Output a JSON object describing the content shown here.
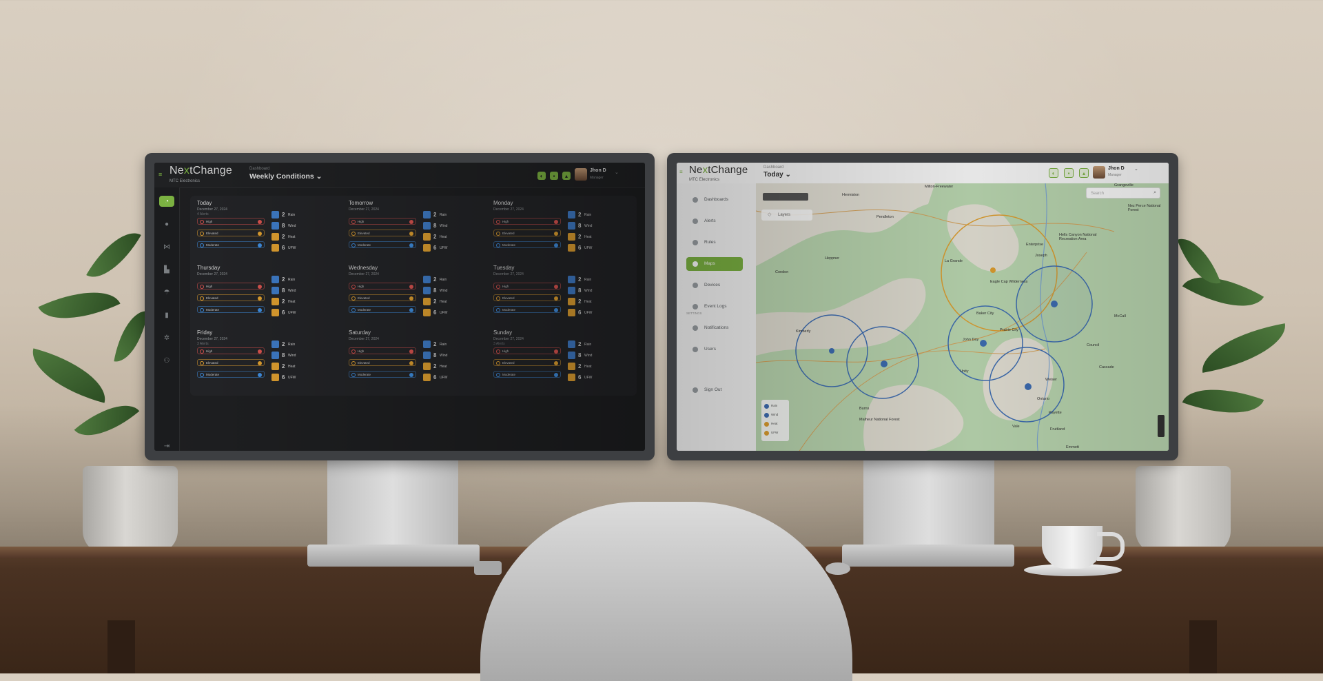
{
  "scene": {
    "wall_color": "#d4c9ba",
    "desk_color": "#4a3222"
  },
  "left_app": {
    "brand": {
      "prefix": "Ne",
      "x": "x",
      "suffix": "tChange",
      "company": "MTC Electronics"
    },
    "breadcrumb": "Dashboard",
    "page_title": "Weekly Conditions",
    "user": {
      "name": "Jhon D",
      "role": "Manager"
    },
    "accent": "#7cb342",
    "sidebar_icons": [
      "dashboard-icon",
      "alert-icon",
      "rules-icon",
      "maps-icon",
      "devices-icon",
      "logs-icon",
      "notifications-icon",
      "users-icon",
      "sign-out-icon"
    ],
    "days": [
      {
        "name": "Today",
        "date": "December 27, 2024",
        "count": "4 Alerts"
      },
      {
        "name": "Tomorrow",
        "date": "December 27, 2024",
        "count": ""
      },
      {
        "name": "Monday",
        "date": "December 27, 2024",
        "count": ""
      },
      {
        "name": "Thursday",
        "date": "December 27, 2024",
        "count": ""
      },
      {
        "name": "Wednesday",
        "date": "December 27, 2024",
        "count": ""
      },
      {
        "name": "Tuesday",
        "date": "December 27, 2024",
        "count": ""
      },
      {
        "name": "Friday",
        "date": "December 27, 2024",
        "count": "3 Alerts"
      },
      {
        "name": "Saturday",
        "date": "December 27, 2024",
        "count": ""
      },
      {
        "name": "Sunday",
        "date": "December 27, 2024",
        "count": "3 Alerts"
      }
    ],
    "alert_levels": [
      {
        "label": "High",
        "color": "#d9534f"
      },
      {
        "label": "Elevated",
        "color": "#e0a030"
      },
      {
        "label": "Moderate",
        "color": "#3f8ee0"
      }
    ],
    "metrics": [
      {
        "value": "2",
        "label": "Rain",
        "color": "#3f7cc8"
      },
      {
        "value": "8",
        "label": "Wind",
        "color": "#3f7cc8"
      },
      {
        "value": "2",
        "label": "Heat",
        "color": "#e0a030"
      },
      {
        "value": "6",
        "label": "UFW",
        "color": "#e0a030"
      }
    ]
  },
  "right_app": {
    "brand": {
      "prefix": "Ne",
      "x": "x",
      "suffix": "tChange",
      "company": "MTC Electronics"
    },
    "breadcrumb": "Dashboard",
    "page_title": "Today",
    "user": {
      "name": "Jhon D",
      "role": "Manager"
    },
    "nav": [
      {
        "label": "Dashboards",
        "active": false
      },
      {
        "label": "Alerts",
        "active": false
      },
      {
        "label": "Rules",
        "active": false
      },
      {
        "label": "Maps",
        "active": true
      },
      {
        "label": "Devices",
        "active": false
      },
      {
        "label": "Event Logs",
        "active": false
      }
    ],
    "settings_header": "SETTINGS",
    "settings_nav": [
      {
        "label": "Notifications"
      },
      {
        "label": "Users"
      }
    ],
    "sign_out": "Sign Out",
    "map": {
      "search_placeholder": "Search",
      "layers_label": "Layers",
      "legend": [
        {
          "label": "Rain",
          "color": "#3f6fb5"
        },
        {
          "label": "Wind",
          "color": "#3f6fb5"
        },
        {
          "label": "Heat",
          "color": "#e0a030"
        },
        {
          "label": "UFW",
          "color": "#e0a030"
        }
      ],
      "places": [
        "Milton-Freewater",
        "Hermiston",
        "Pendleton",
        "Heppner",
        "Condon",
        "La Grande",
        "Enterprise",
        "Joseph",
        "Hells Canyon National Recreation Area",
        "Eagle Cap Wilderness",
        "Baker City",
        "Kimberly",
        "John Day",
        "Prairie City",
        "Unity",
        "Burns",
        "Vale",
        "Ontario",
        "Fruitland",
        "Payette",
        "Weiser",
        "Council",
        "Cascade",
        "McCall",
        "Grangeville",
        "Nez Perce National Forest",
        "Malheur National Forest",
        "Emmett"
      ]
    }
  }
}
